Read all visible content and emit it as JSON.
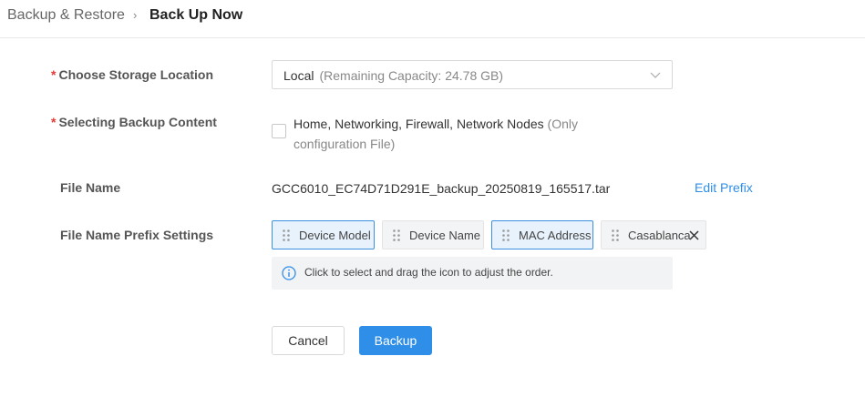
{
  "breadcrumb": {
    "parent": "Backup & Restore",
    "separator": "›",
    "current": "Back Up Now"
  },
  "form": {
    "storage": {
      "label": "Choose Storage Location",
      "value": "Local",
      "hint": "(Remaining Capacity: 24.78 GB)"
    },
    "content": {
      "label": "Selecting Backup Content",
      "checked": false,
      "option_text": "Home, Networking, Firewall, Network Nodes",
      "option_note": "(Only configuration File)"
    },
    "file_name": {
      "label": "File Name",
      "value": "GCC6010_EC74D71D291E_backup_20250819_165517.tar",
      "edit_link": "Edit Prefix"
    },
    "prefix": {
      "label": "File Name Prefix Settings",
      "chips": [
        {
          "label": "Device Model",
          "selected": true
        },
        {
          "label": "Device Name",
          "selected": false
        },
        {
          "label": "MAC Address",
          "selected": true
        },
        {
          "label": "Casablanca",
          "selected": false,
          "removable": true
        }
      ],
      "tip": "Click to select and drag the icon to adjust the order."
    }
  },
  "actions": {
    "cancel": "Cancel",
    "backup": "Backup"
  },
  "colors": {
    "accent": "#2f8ee8",
    "required": "#e53935",
    "chip_selected_bg": "#e8f2fc",
    "chip_bg": "#f3f4f6"
  },
  "icons": [
    "chevron-right-icon",
    "chevron-down-icon",
    "drag-handle-icon",
    "close-icon",
    "info-icon"
  ]
}
